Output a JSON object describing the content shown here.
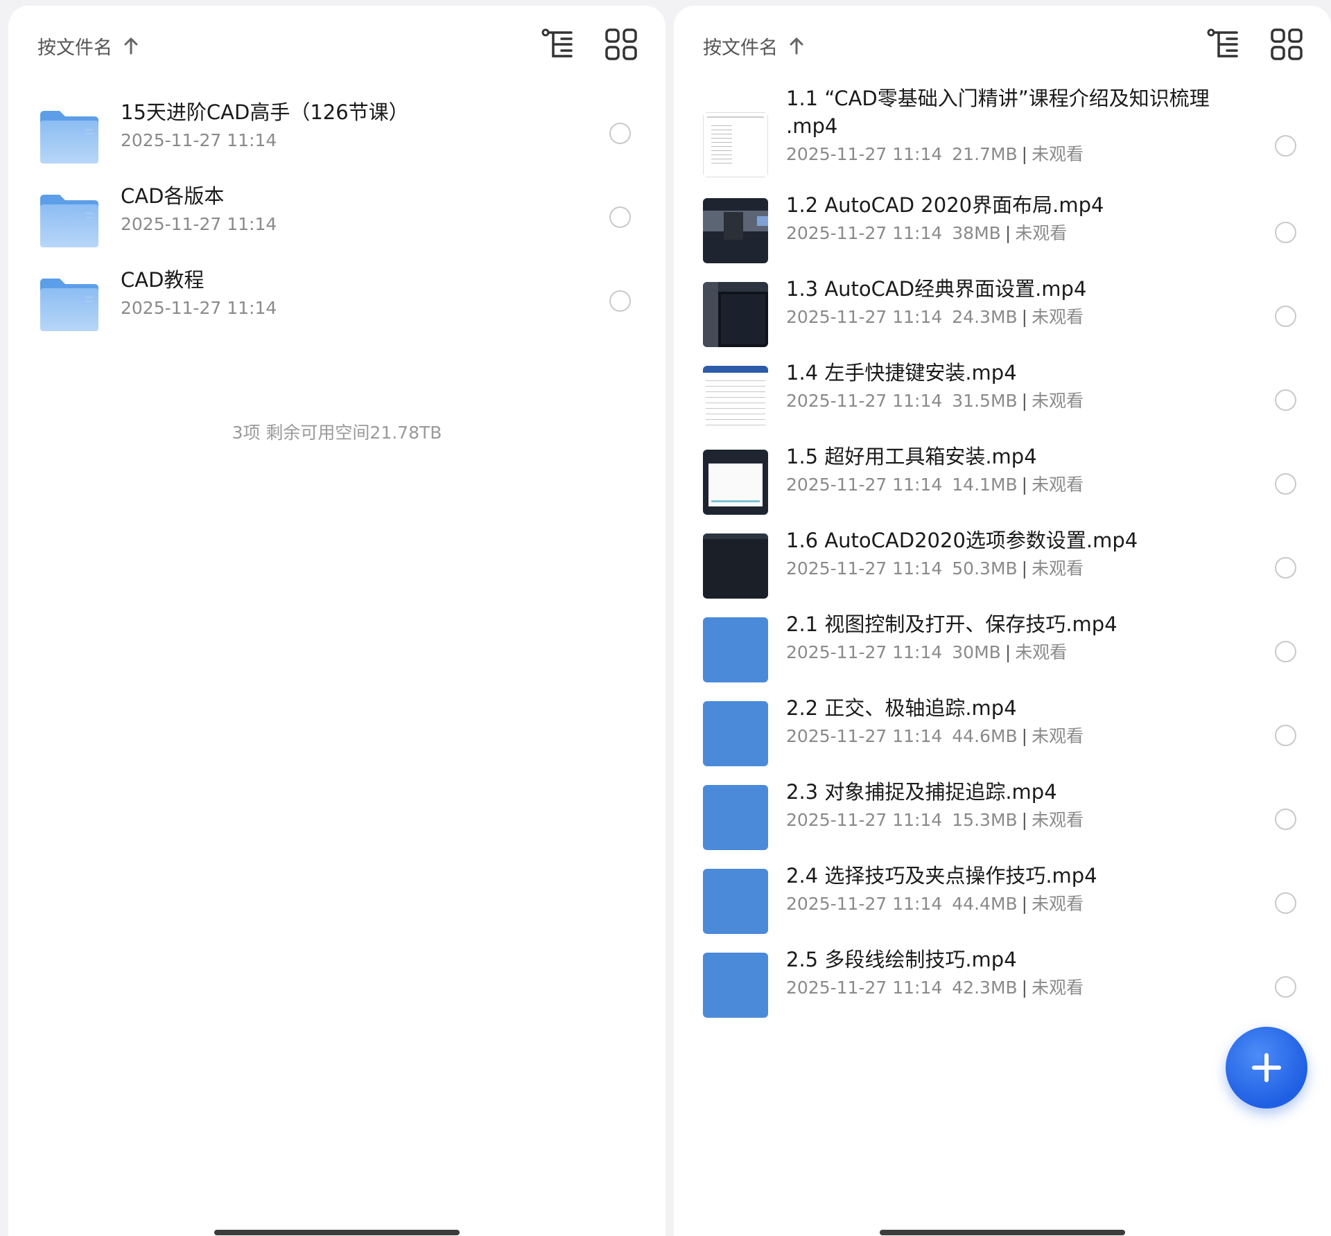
{
  "left_panel": {
    "sort_label": "按文件名",
    "folders": [
      {
        "name": "15天进阶CAD高手（126节课）",
        "date": "2025-11-27 11:14"
      },
      {
        "name": "CAD各版本",
        "date": "2025-11-27 11:14"
      },
      {
        "name": "CAD教程",
        "date": "2025-11-27 11:14"
      }
    ],
    "footer": "3项  剩余可用空间21.78TB"
  },
  "right_panel": {
    "sort_label": "按文件名",
    "files": [
      {
        "name": "1.1 “CAD零基础入门精讲”课程介绍及知识梳理",
        "name2": ".mp4",
        "date": "2025-11-27 11:14",
        "size": "21.7MB",
        "status": "未观看",
        "thumb": "doc"
      },
      {
        "name": "1.2 AutoCAD 2020界面布局.mp4",
        "date": "2025-11-27 11:14",
        "size": "38MB",
        "status": "未观看",
        "thumb": "dark-ui"
      },
      {
        "name": "1.3 AutoCAD经典界面设置.mp4",
        "date": "2025-11-27 11:14",
        "size": "24.3MB",
        "status": "未观看",
        "thumb": "dark-panel"
      },
      {
        "name": "1.4 左手快捷键安装.mp4",
        "date": "2025-11-27 11:14",
        "size": "31.5MB",
        "status": "未观看",
        "thumb": "table"
      },
      {
        "name": "1.5 超好用工具箱安装.mp4",
        "date": "2025-11-27 11:14",
        "size": "14.1MB",
        "status": "未观看",
        "thumb": "dialog"
      },
      {
        "name": "1.6 AutoCAD2020选项参数设置.mp4",
        "date": "2025-11-27 11:14",
        "size": "50.3MB",
        "status": "未观看",
        "thumb": "dark"
      },
      {
        "name": "2.1 视图控制及打开、保存技巧.mp4",
        "date": "2025-11-27 11:14",
        "size": "30MB",
        "status": "未观看",
        "thumb": "blue"
      },
      {
        "name": "2.2 正交、极轴追踪.mp4",
        "date": "2025-11-27 11:14",
        "size": "44.6MB",
        "status": "未观看",
        "thumb": "blue"
      },
      {
        "name": "2.3 对象捕捉及捕捉追踪.mp4",
        "date": "2025-11-27 11:14",
        "size": "15.3MB",
        "status": "未观看",
        "thumb": "blue"
      },
      {
        "name": "2.4 选择技巧及夹点操作技巧.mp4",
        "date": "2025-11-27 11:14",
        "size": "44.4MB",
        "status": "未观看",
        "thumb": "blue"
      },
      {
        "name": "2.5 多段线绘制技巧.mp4",
        "date": "2025-11-27 11:14",
        "size": "42.3MB",
        "status": "未观看",
        "thumb": "blue"
      }
    ]
  },
  "icons": {
    "sort": "arrow-up-icon",
    "tree": "tree-view-icon",
    "grid": "grid-view-icon",
    "folder": "folder-icon",
    "fab": "plus-icon"
  },
  "colors": {
    "accent": "#2b6ef0",
    "thumb_blue": "#4a8ad9",
    "folder_blue": "#7fb2ee",
    "meta_gray": "#8a8a8a"
  }
}
